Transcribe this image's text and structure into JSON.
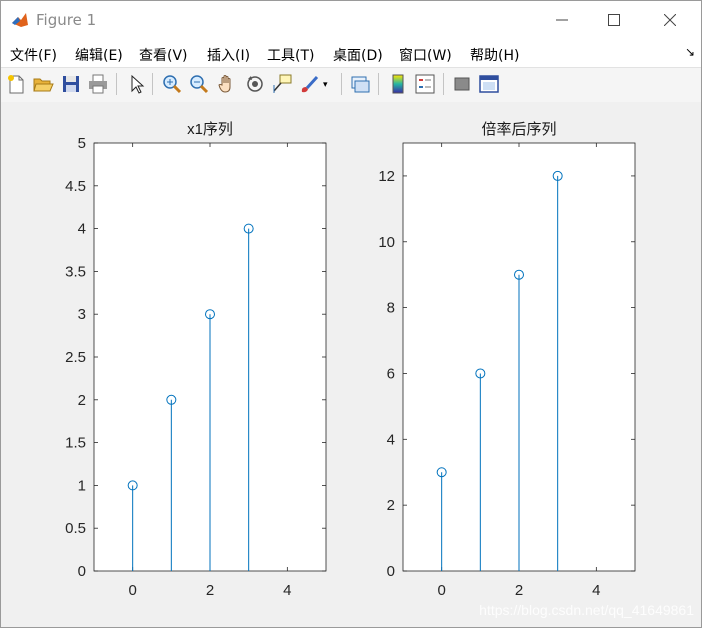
{
  "window": {
    "title": "Figure 1"
  },
  "window_controls": {
    "minimize": "—",
    "maximize": "☐",
    "close": "✕"
  },
  "menu": {
    "items": [
      {
        "label": "文件(F)"
      },
      {
        "label": "编辑(E)"
      },
      {
        "label": "查看(V)"
      },
      {
        "label": "插入(I)"
      },
      {
        "label": "工具(T)"
      },
      {
        "label": "桌面(D)"
      },
      {
        "label": "窗口(W)"
      },
      {
        "label": "帮助(H)"
      }
    ],
    "overflow_glyph": "↘"
  },
  "toolbar": {
    "icons": [
      "new-figure-icon",
      "open-file-icon",
      "save-icon",
      "print-icon",
      "select-arrow-icon",
      "zoom-in-icon",
      "zoom-out-icon",
      "pan-hand-icon",
      "rotate-3d-icon",
      "data-cursor-icon",
      "brush-icon",
      "link-plot-icon",
      "colorbar-icon",
      "legend-icon",
      "hide-plot-tools-icon",
      "show-plot-tools-icon"
    ]
  },
  "colors": {
    "stem": "#0072bd",
    "axes_bg": "#ffffff",
    "figure_bg": "#f0f0f0"
  },
  "chart_data": [
    {
      "type": "stem",
      "title": "x1序列",
      "x": [
        0,
        1,
        2,
        3
      ],
      "values": [
        1,
        2,
        3,
        4
      ],
      "xlim": [
        -1,
        5
      ],
      "ylim": [
        0,
        5
      ],
      "xticks": [
        0,
        2,
        4
      ],
      "yticks": [
        0,
        0.5,
        1,
        1.5,
        2,
        2.5,
        3,
        3.5,
        4,
        4.5,
        5
      ],
      "xlabel": "",
      "ylabel": "",
      "grid": false
    },
    {
      "type": "stem",
      "title": "倍率后序列",
      "x": [
        0,
        1,
        2,
        3
      ],
      "values": [
        3,
        6,
        9,
        12
      ],
      "xlim": [
        -1,
        5
      ],
      "ylim": [
        0,
        13
      ],
      "xticks": [
        0,
        2,
        4
      ],
      "yticks": [
        0,
        2,
        4,
        6,
        8,
        10,
        12
      ],
      "xlabel": "",
      "ylabel": "",
      "grid": false
    }
  ],
  "watermark": "https://blog.csdn.net/qq_41649861"
}
